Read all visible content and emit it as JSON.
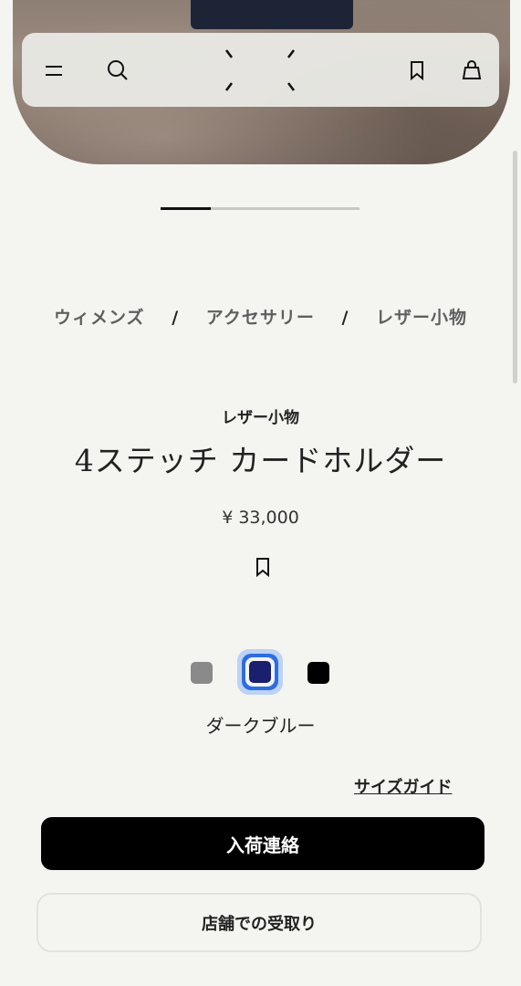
{
  "header": {
    "icons": {
      "menu": "menu-icon",
      "search": "search-icon",
      "logo": "brand-stitch-logo",
      "wishlist": "bookmark-icon",
      "cart": "shopping-bag-icon"
    }
  },
  "carousel": {
    "total": 4,
    "active": 1
  },
  "breadcrumb": {
    "items": [
      "ウィメンズ",
      "アクセサリー",
      "レザー小物"
    ],
    "separator": "/"
  },
  "product": {
    "category": "レザー小物",
    "title": "4ステッチ カードホルダー",
    "price": "¥ 33,000",
    "selected_color": "ダークブルー",
    "swatches": [
      {
        "name": "gray",
        "color": "#8a8a8a",
        "selected": false
      },
      {
        "name": "dark-blue",
        "color": "#1a1f6e",
        "selected": true
      },
      {
        "name": "black",
        "color": "#000000",
        "selected": false
      }
    ]
  },
  "links": {
    "size_guide": "サイズガイド"
  },
  "actions": {
    "notify": "入荷連絡",
    "store_pickup": "店舗での受取り"
  }
}
